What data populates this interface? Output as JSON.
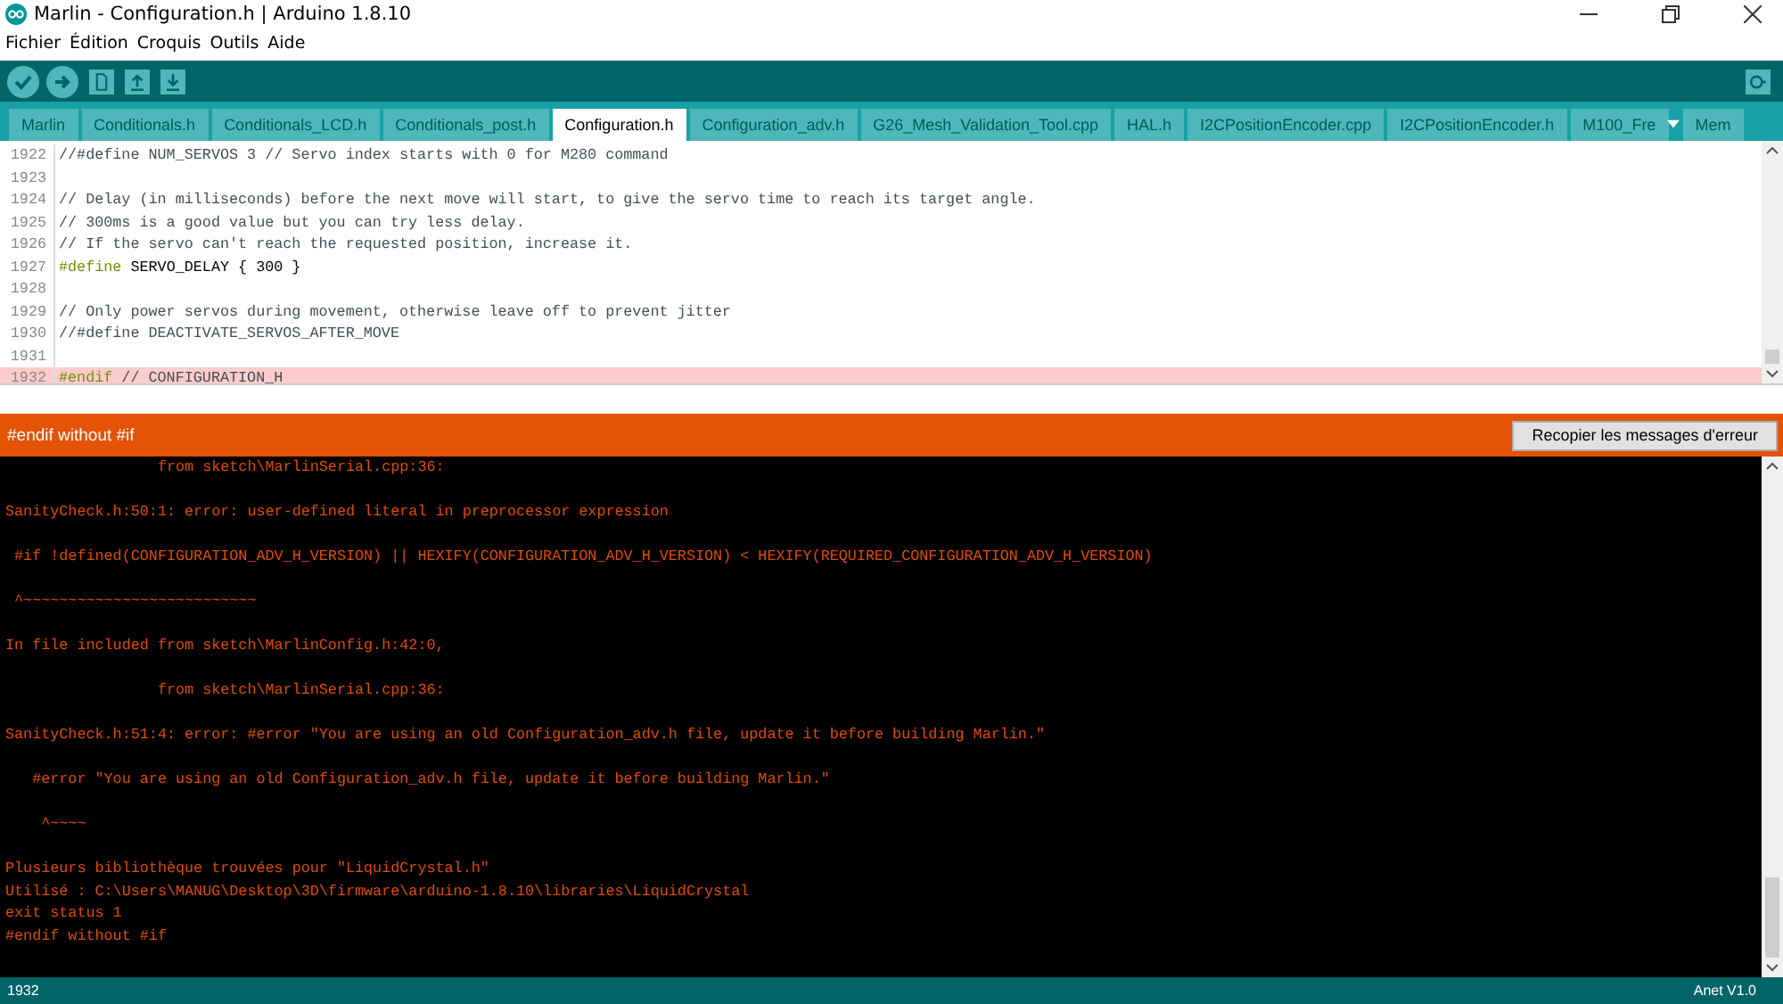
{
  "window": {
    "title": "Marlin - Configuration.h | Arduino 1.8.10"
  },
  "menu": [
    "Fichier",
    "Édition",
    "Croquis",
    "Outils",
    "Aide"
  ],
  "tabs": [
    {
      "label": "Marlin",
      "selected": false
    },
    {
      "label": "Conditionals.h",
      "selected": false
    },
    {
      "label": "Conditionals_LCD.h",
      "selected": false
    },
    {
      "label": "Conditionals_post.h",
      "selected": false
    },
    {
      "label": "Configuration.h",
      "selected": true
    },
    {
      "label": "Configuration_adv.h",
      "selected": false
    },
    {
      "label": "G26_Mesh_Validation_Tool.cpp",
      "selected": false
    },
    {
      "label": "HAL.h",
      "selected": false
    },
    {
      "label": "I2CPositionEncoder.cpp",
      "selected": false
    },
    {
      "label": "I2CPositionEncoder.h",
      "selected": false
    },
    {
      "label": "M100_Fre",
      "selected": false
    },
    {
      "label": "Mem",
      "selected": false
    }
  ],
  "editor": {
    "lines": [
      {
        "number": "1922",
        "error": false,
        "segments": [
          {
            "kind": "comment",
            "text": "//#define NUM_SERVOS 3 // Servo index starts with 0 for M280 command"
          }
        ]
      },
      {
        "number": "1923",
        "error": false
      },
      {
        "number": "1924",
        "error": false,
        "segments": [
          {
            "kind": "comment",
            "text": "// Delay (in milliseconds) before the next move will start, to give the servo time to reach its target angle."
          }
        ]
      },
      {
        "number": "1925",
        "error": false,
        "segments": [
          {
            "kind": "comment",
            "text": "// 300ms is a good value but you can try less delay."
          }
        ]
      },
      {
        "number": "1926",
        "error": false,
        "segments": [
          {
            "kind": "comment",
            "text": "// If the servo can't reach the requested position, increase it."
          }
        ]
      },
      {
        "number": "1927",
        "error": false,
        "segments": [
          {
            "kind": "keyword",
            "text": "#define"
          },
          {
            "kind": "plain",
            "text": " SERVO_DELAY { 300 }"
          }
        ]
      },
      {
        "number": "1928",
        "error": false
      },
      {
        "number": "1929",
        "error": false,
        "segments": [
          {
            "kind": "comment",
            "text": "// Only power servos during movement, otherwise leave off to prevent jitter"
          }
        ]
      },
      {
        "number": "1930",
        "error": false,
        "segments": [
          {
            "kind": "comment",
            "text": "//#define DEACTIVATE_SERVOS_AFTER_MOVE"
          }
        ]
      },
      {
        "number": "1931",
        "error": false
      },
      {
        "number": "1932",
        "error": true,
        "segments": [
          {
            "kind": "keyword",
            "text": "#endif"
          },
          {
            "kind": "comment",
            "text": " // CONFIGURATION_H"
          }
        ]
      }
    ]
  },
  "error_bar": {
    "message": "#endif without #if",
    "copy_button": "Recopier les messages d'erreur"
  },
  "console": [
    [
      "                 from sketch\\MarlinSerial.cpp:36:"
    ],
    [
      "SanityCheck.h:50:1: error: user-defined literal in preprocessor expression"
    ],
    [
      " #if !defined(CONFIGURATION_ADV_H_VERSION) || HEXIFY(CONFIGURATION_ADV_H_VERSION) < HEXIFY(REQUIRED_CONFIGURATION_ADV_H_VERSION)"
    ],
    [
      " ^~~~~~~~~~~~~~~~~~~~~~~~~~~"
    ],
    [
      "In file included from sketch\\MarlinConfig.h:42:0,"
    ],
    [
      "                 from sketch\\MarlinSerial.cpp:36:"
    ],
    [
      "SanityCheck.h:51:4: error: #error \"You are using an old Configuration_adv.h file, update it before building Marlin.\""
    ],
    [
      "   #error \"You are using an old Configuration_adv.h file, update it before building Marlin.\""
    ],
    [
      "    ^~~~~"
    ],
    [
      "Plusieurs bibliothèque trouvées pour \"LiquidCrystal.h\"",
      "Utilisé : C:\\Users\\MANUG\\Desktop\\3D\\firmware\\arduino-1.8.10\\libraries\\LiquidCrystal",
      "exit status 1",
      "#endif without #if"
    ]
  ],
  "status_bar": {
    "line": "1932",
    "board": "Anet V1.0"
  }
}
